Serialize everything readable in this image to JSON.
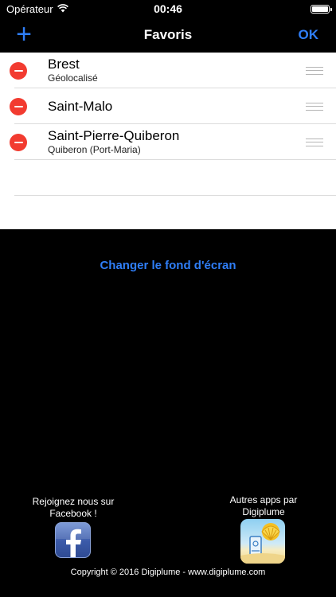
{
  "status_bar": {
    "carrier": "Opérateur",
    "time": "00:46",
    "icons": [
      "wifi-icon",
      "battery-icon"
    ]
  },
  "nav": {
    "title": "Favoris",
    "add_label": "+",
    "ok_label": "OK"
  },
  "favorites": [
    {
      "title": "Brest",
      "subtitle": "Géolocalisé"
    },
    {
      "title": "Saint-Malo",
      "subtitle": ""
    },
    {
      "title": "Saint-Pierre-Quiberon",
      "subtitle": "Quiberon (Port-Maria)"
    }
  ],
  "wallpaper_link": "Changer le fond d'écran",
  "footer": {
    "facebook_text_line1": "Rejoignez nous sur",
    "facebook_text_line2": "Facebook !",
    "apps_text_line1": "Autres apps par",
    "apps_text_line2": "Digiplume",
    "copyright": "Copyright © 2016 Digiplume - www.digiplume.com"
  },
  "colors": {
    "accent": "#2f7ef7",
    "delete": "#f23b30",
    "background": "#000000",
    "list_background": "#ffffff"
  }
}
